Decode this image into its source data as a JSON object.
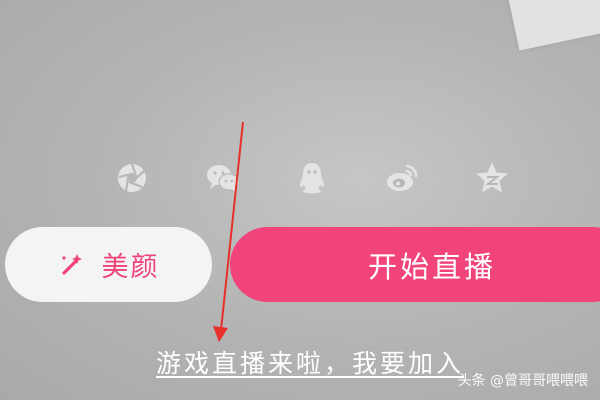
{
  "share": {
    "icons": [
      {
        "name": "camera-shutter-icon"
      },
      {
        "name": "wechat-icon"
      },
      {
        "name": "qq-icon"
      },
      {
        "name": "weibo-icon"
      },
      {
        "name": "qzone-icon"
      }
    ],
    "icon_color": "#e4e4e4"
  },
  "buttons": {
    "beauty_label": "美颜",
    "beauty_icon": "magic-wand-icon",
    "start_label": "开始直播"
  },
  "footer": {
    "join_link": "游戏直播来啦，我要加入"
  },
  "watermark": "头条 @曾哥哥喂喂喂",
  "colors": {
    "accent": "#f0447b",
    "annotation_arrow": "#e8302a"
  }
}
